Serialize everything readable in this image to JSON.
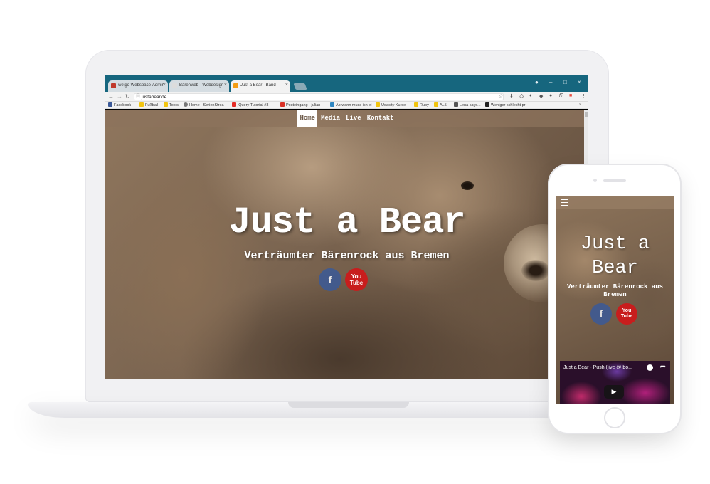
{
  "browser": {
    "tabs": [
      {
        "label": "wetgo Webspace-Admin",
        "icon_color": "#c0392b"
      },
      {
        "label": "Bärenweb - Webdesign",
        "icon_color": "#dcdcdc"
      },
      {
        "label": "Just a Bear - Band",
        "icon_color": "#f39c12"
      }
    ],
    "url": "justabear.de",
    "bookmarks": [
      {
        "label": "Facebook",
        "icon_color": "#3b5998"
      },
      {
        "label": "Fußball",
        "icon_color": "#f1c40f"
      },
      {
        "label": "Tools",
        "icon_color": "#f1c40f"
      },
      {
        "label": "Home - SerienStrea",
        "icon_color": "#777777"
      },
      {
        "label": "jQuery Tutorial #3 -",
        "icon_color": "#e52d27"
      },
      {
        "label": "Posteingang - julian",
        "icon_color": "#d93025"
      },
      {
        "label": "Ab wann muss ich ei",
        "icon_color": "#2e86c1"
      },
      {
        "label": "Udacity Kurse",
        "icon_color": "#f1c40f"
      },
      {
        "label": "Ruby",
        "icon_color": "#f1c40f"
      },
      {
        "label": "AL5",
        "icon_color": "#f1c40f"
      },
      {
        "label": "Lena says...",
        "icon_color": "#555555"
      },
      {
        "label": "Weniger schlecht pr",
        "icon_color": "#222222"
      }
    ],
    "bookmarks_more": "»"
  },
  "site": {
    "nav": [
      "Home",
      "Media",
      "Live",
      "Kontakt"
    ],
    "title": "Just a Bear",
    "subtitle": "Verträumter Bärenrock aus Bremen",
    "facebook_glyph": "f",
    "youtube_glyph": "You\nTube"
  },
  "mobile": {
    "title": "Just a Bear",
    "subtitle": "Verträumter Bärenrock aus Bremen",
    "video_title": "Just a Bear - Push (live @ bo..."
  }
}
